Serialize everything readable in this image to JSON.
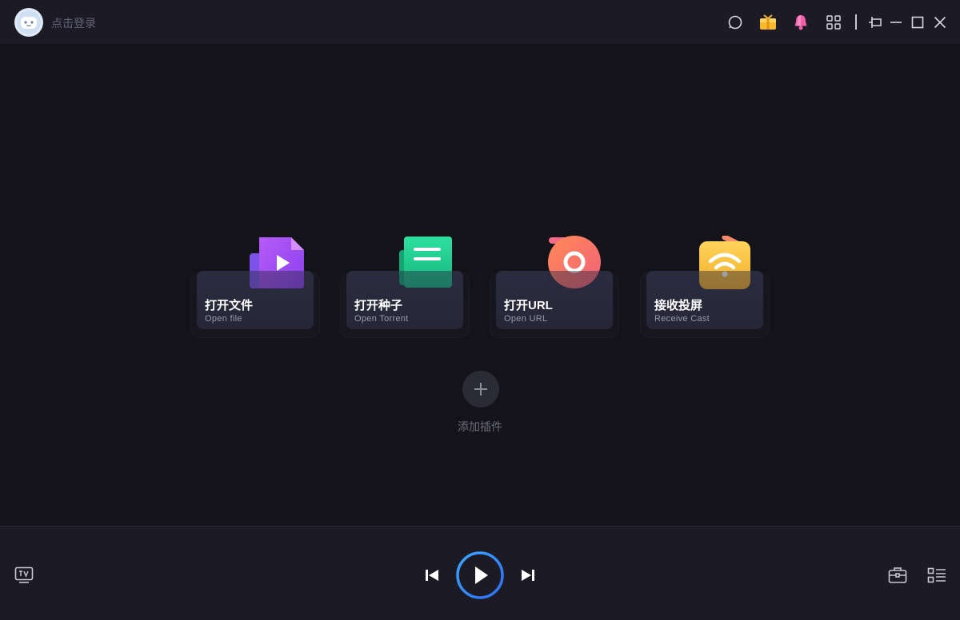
{
  "titlebar": {
    "login_text": "点击登录",
    "icons": [
      "avatar",
      "search-icon",
      "gift-icon",
      "bell-icon",
      "apps-grid-icon",
      "pin-icon",
      "minimize-icon",
      "maximize-icon",
      "close-icon"
    ]
  },
  "cards": [
    {
      "title": "打开文件",
      "subtitle": "Open file",
      "icon": "video-file-icon",
      "color": "#a64cf2"
    },
    {
      "title": "打开种子",
      "subtitle": "Open Torrent",
      "icon": "torrent-doc-icon",
      "color": "#22d193"
    },
    {
      "title": "打开URL",
      "subtitle": "Open URL",
      "icon": "url-disc-icon",
      "color": "#f7795c"
    },
    {
      "title": "接收投屏",
      "subtitle": "Receive Cast",
      "icon": "cast-wifi-icon",
      "color": "#f5c443"
    }
  ],
  "add_plugin": {
    "label": "添加插件"
  },
  "player": {
    "icons": [
      "tv-icon",
      "previous-icon",
      "play-icon",
      "next-icon",
      "toolbox-icon",
      "playlist-icon"
    ],
    "accent": "#2f86f6"
  }
}
